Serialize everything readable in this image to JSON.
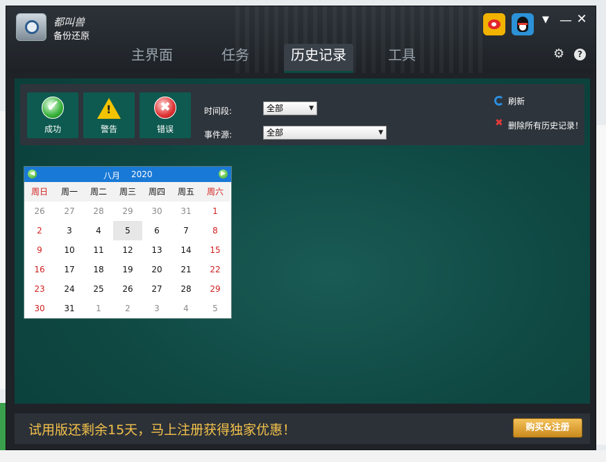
{
  "app": {
    "brand": "都叫兽",
    "name": "备份还原"
  },
  "tabs": [
    {
      "label": "主界面",
      "active": false
    },
    {
      "label": "任务",
      "active": false
    },
    {
      "label": "历史记录",
      "active": true
    },
    {
      "label": "工具",
      "active": false
    }
  ],
  "titlebar_icons": [
    "weibo-icon",
    "qq-icon",
    "skin-icon",
    "minimize-icon",
    "close-icon",
    "gear-icon",
    "help-icon"
  ],
  "titlebar": {
    "minimize": "—",
    "close": "✕",
    "help": "?"
  },
  "filters": {
    "success_label": "成功",
    "warning_label": "警告",
    "error_label": "错误",
    "time_range_label": "时间段:",
    "time_range_value": "全部",
    "event_source_label": "事件源:",
    "event_source_value": "全部",
    "refresh_label": "刷新",
    "delete_all_label": "删除所有历史记录！"
  },
  "calendar": {
    "month": "八月",
    "year": "2020",
    "weekdays": [
      "周日",
      "周一",
      "周二",
      "周三",
      "周四",
      "周五",
      "周六"
    ],
    "weeks": [
      [
        "26",
        "27",
        "28",
        "29",
        "30",
        "31",
        "1"
      ],
      [
        "2",
        "3",
        "4",
        "5",
        "6",
        "7",
        "8"
      ],
      [
        "9",
        "10",
        "11",
        "12",
        "13",
        "14",
        "15"
      ],
      [
        "16",
        "17",
        "18",
        "19",
        "20",
        "21",
        "22"
      ],
      [
        "23",
        "24",
        "25",
        "26",
        "27",
        "28",
        "29"
      ],
      [
        "30",
        "31",
        "1",
        "2",
        "3",
        "4",
        "5"
      ]
    ],
    "today": "5"
  },
  "footer": {
    "trial_text": "试用版还剩余15天，马上注册获得独家优惠！",
    "buy_label": "购买&注册"
  },
  "colors": {
    "accent_green": "#0e5a50",
    "content_bg": "#0e4641",
    "calendar_header": "#1979d6",
    "trial_text": "#f3c14a",
    "weekend": "#d12020"
  }
}
